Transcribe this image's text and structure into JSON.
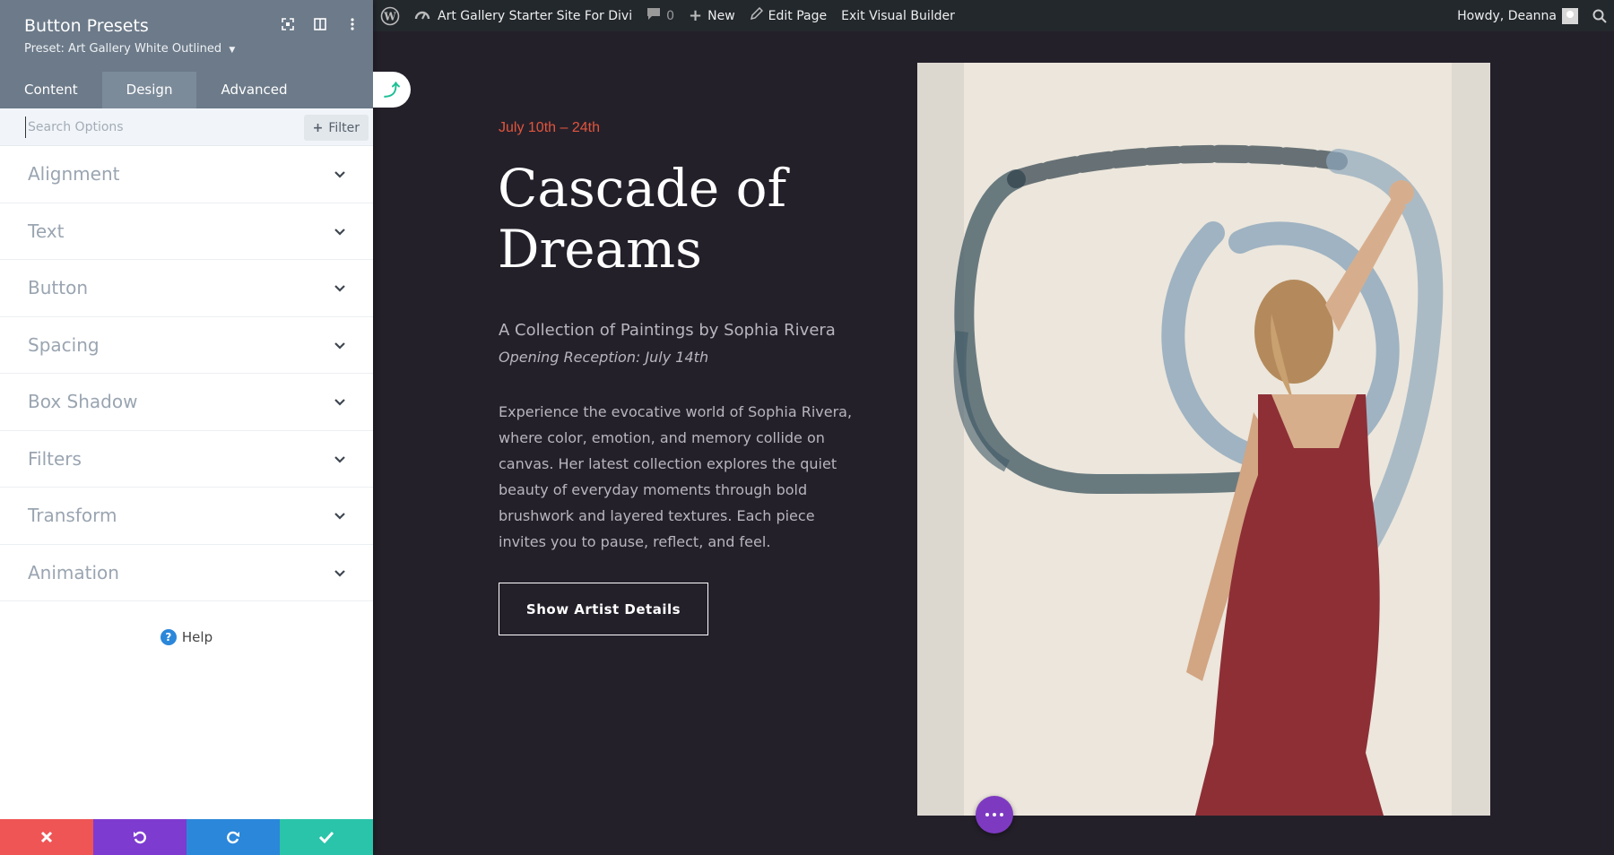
{
  "adminbar": {
    "site_name": "Art Gallery Starter Site For Divi",
    "comments_count": "0",
    "new_label": "New",
    "edit_label": "Edit Page",
    "exit_label": "Exit Visual Builder",
    "howdy": "Howdy, Deanna"
  },
  "panel": {
    "title": "Button Presets",
    "preset": "Preset: Art Gallery White Outlined",
    "tabs": [
      {
        "label": "Content"
      },
      {
        "label": "Design"
      },
      {
        "label": "Advanced"
      }
    ],
    "active_tab": "Design",
    "search_placeholder": "Search Options",
    "filter_label": "Filter",
    "groups": [
      {
        "label": "Alignment"
      },
      {
        "label": "Text"
      },
      {
        "label": "Button"
      },
      {
        "label": "Spacing"
      },
      {
        "label": "Box Shadow"
      },
      {
        "label": "Filters"
      },
      {
        "label": "Transform"
      },
      {
        "label": "Animation"
      }
    ],
    "help_label": "Help",
    "footer_colors": {
      "discard": "#ef5555",
      "undo": "#7e3bd0",
      "redo": "#2b87da",
      "save": "#29c4a9"
    },
    "header_color": "#6c7a89"
  },
  "content": {
    "date": "July 10th – 24th",
    "title": "Cascade of Dreams",
    "subtitle": "A Collection of Paintings by Sophia Rivera",
    "reception": "Opening Reception: July 14th",
    "body": "Experience the evocative world of Sophia Rivera, where color, emotion, and memory collide on canvas. Her latest collection explores the quiet beauty of everyday moments through bold brushwork and layered textures. Each piece invites you to pause, reflect, and feel.",
    "button_label": "Show Artist Details",
    "accent_color": "#e0553d",
    "background_color": "#24202a"
  }
}
